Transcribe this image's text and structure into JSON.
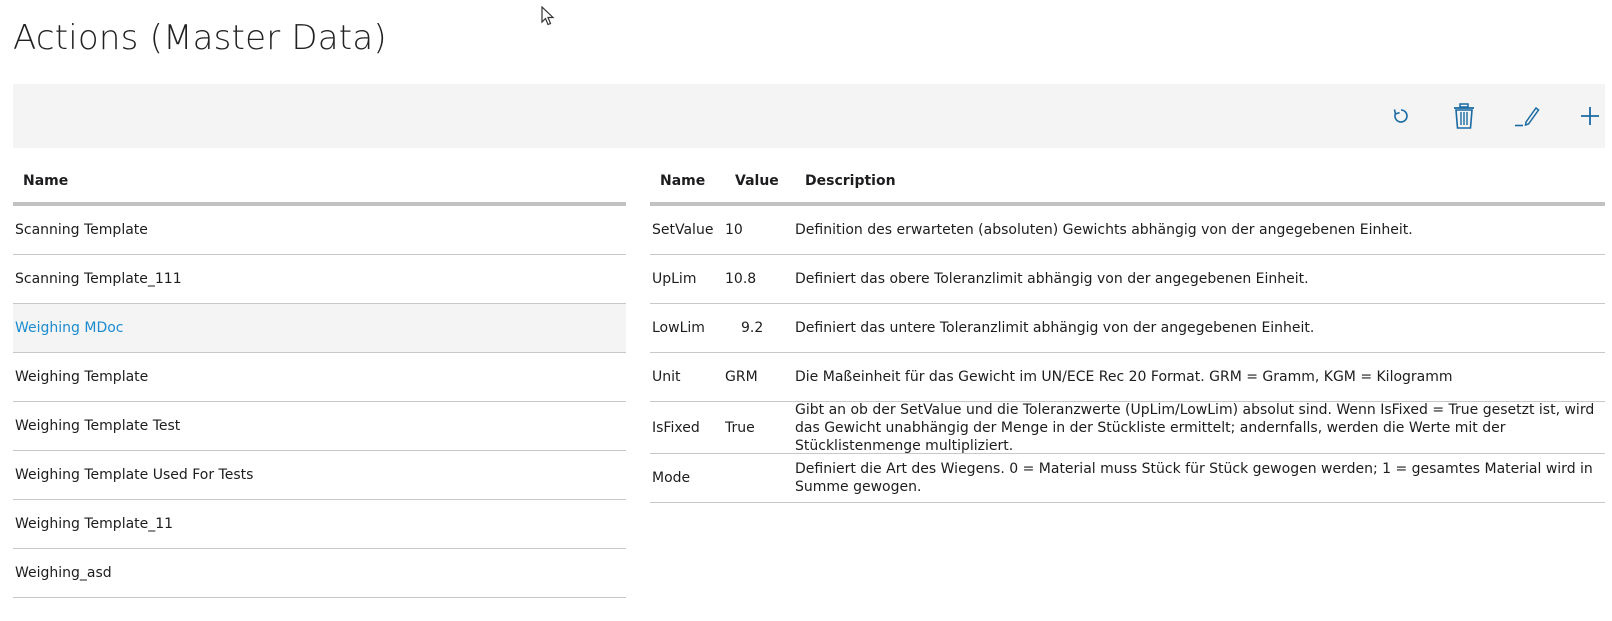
{
  "page": {
    "title": "Actions (Master Data)"
  },
  "toolbar": {
    "buttons": [
      {
        "name": "refresh",
        "icon": "refresh-icon"
      },
      {
        "name": "delete",
        "icon": "trash-icon"
      },
      {
        "name": "edit",
        "icon": "pencil-icon"
      },
      {
        "name": "add",
        "icon": "plus-icon"
      }
    ],
    "icon_color": "#1a6aa3"
  },
  "actions_list": {
    "header": "Name",
    "selected_index": 2,
    "items": [
      "Scanning Template",
      "Scanning Template_111",
      "Weighing MDoc",
      "Weighing Template",
      "Weighing Template Test",
      "Weighing Template Used For Tests",
      "Weighing Template_11",
      "Weighing_asd"
    ]
  },
  "parameters": {
    "headers": {
      "name": "Name",
      "value": "Value",
      "description": "Description"
    },
    "rows": [
      {
        "name": "SetValue",
        "value": "10",
        "description": "Definition des erwarteten (absoluten) Gewichts abhängig von der angegebenen Einheit."
      },
      {
        "name": "UpLim",
        "value": "10.8",
        "description": "Definiert das obere Toleranzlimit abhängig von der angegebenen Einheit."
      },
      {
        "name": "LowLim",
        "value": "9.2",
        "description": "Definiert das untere Toleranzlimit abhängig von der angegebenen Einheit."
      },
      {
        "name": "Unit",
        "value": "GRM",
        "description": "Die Maßeinheit für das Gewicht im UN/ECE Rec 20 Format. GRM = Gramm, KGM = Kilogramm"
      },
      {
        "name": "IsFixed",
        "value": "True",
        "description": "Gibt an ob der SetValue und die Toleranzwerte (UpLim/LowLim) absolut sind. Wenn IsFixed = True gesetzt ist, wird das Gewicht unabhängig der Menge in der Stückliste ermittelt; andernfalls, werden die Werte mit der Stücklistenmenge multipliziert."
      },
      {
        "name": "Mode",
        "value": "",
        "description": "Definiert die Art des Wiegens. 0 = Material muss Stück für Stück gewogen werden; 1 = gesamtes Material wird in Summe gewogen."
      }
    ]
  },
  "colors": {
    "accent": "#1a8ccf",
    "toolbar_bg": "#f4f4f4",
    "divider": "#c8c8c8"
  }
}
